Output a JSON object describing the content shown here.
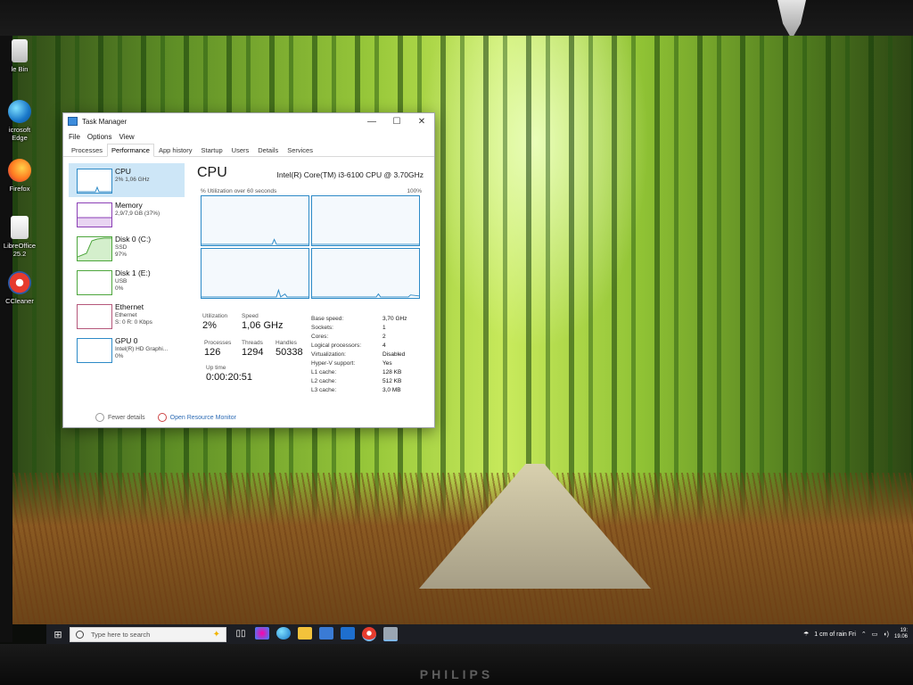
{
  "desktop": {
    "icons": [
      {
        "label": "le Bin",
        "icon": "recycle-bin-icon"
      },
      {
        "label": "icrosoft\nEdge",
        "icon": "edge-icon"
      },
      {
        "label": "Firefox",
        "icon": "firefox-icon"
      },
      {
        "label": "LibreOffice\n25.2",
        "icon": "libreoffice-icon"
      },
      {
        "label": "CCleaner",
        "icon": "ccleaner-icon"
      }
    ],
    "monitor_brand": "PHILIPS"
  },
  "task_manager": {
    "title": "Task Manager",
    "window_controls": {
      "minimize": "—",
      "maximize": "☐",
      "close": "✕"
    },
    "menu": [
      "File",
      "Options",
      "View"
    ],
    "tabs": [
      "Processes",
      "Performance",
      "App history",
      "Startup",
      "Users",
      "Details",
      "Services"
    ],
    "active_tab": "Performance",
    "sidebar": [
      {
        "title": "CPU",
        "sub": "2% 1,06 GHz",
        "color": "#2d8ac7"
      },
      {
        "title": "Memory",
        "sub": "2,9/7,9 GB (37%)",
        "color": "#8b3fb5"
      },
      {
        "title": "Disk 0 (C:)",
        "sub": "SSD\n97%",
        "color": "#4da63c"
      },
      {
        "title": "Disk 1 (E:)",
        "sub": "USB\n0%",
        "color": "#4da63c"
      },
      {
        "title": "Ethernet",
        "sub": "Ethernet\nS: 0 R: 0 Kbps",
        "color": "#b5577a"
      },
      {
        "title": "GPU 0",
        "sub": "Intel(R) HD Graphi...\n0%",
        "color": "#2d8ac7"
      }
    ],
    "cpu": {
      "heading": "CPU",
      "model": "Intel(R) Core(TM) i3-6100 CPU @ 3.70GHz",
      "graph_label": "% Utilization over 60 seconds",
      "graph_max": "100%",
      "utilization_label": "Utilization",
      "utilization": "2%",
      "speed_label": "Speed",
      "speed": "1,06 GHz",
      "processes_label": "Processes",
      "processes": "126",
      "threads_label": "Threads",
      "threads": "1294",
      "handles_label": "Handles",
      "handles": "50338",
      "uptime_label": "Up time",
      "uptime": "0:00:20:51",
      "details": [
        {
          "k": "Base speed:",
          "v": "3,70 GHz"
        },
        {
          "k": "Sockets:",
          "v": "1"
        },
        {
          "k": "Cores:",
          "v": "2"
        },
        {
          "k": "Logical processors:",
          "v": "4"
        },
        {
          "k": "Virtualization:",
          "v": "Disabled"
        },
        {
          "k": "Hyper-V support:",
          "v": "Yes"
        },
        {
          "k": "L1 cache:",
          "v": "128 KB"
        },
        {
          "k": "L2 cache:",
          "v": "512 KB"
        },
        {
          "k": "L3 cache:",
          "v": "3,0 MB"
        }
      ]
    },
    "footer": {
      "fewer_details": "Fewer details",
      "resource_monitor": "Open Resource Monitor"
    }
  },
  "taskbar": {
    "search_placeholder": "Type here to search",
    "weather": "1 cm of rain Fri",
    "clock_line1": "19:",
    "clock_line2": "19.06"
  }
}
